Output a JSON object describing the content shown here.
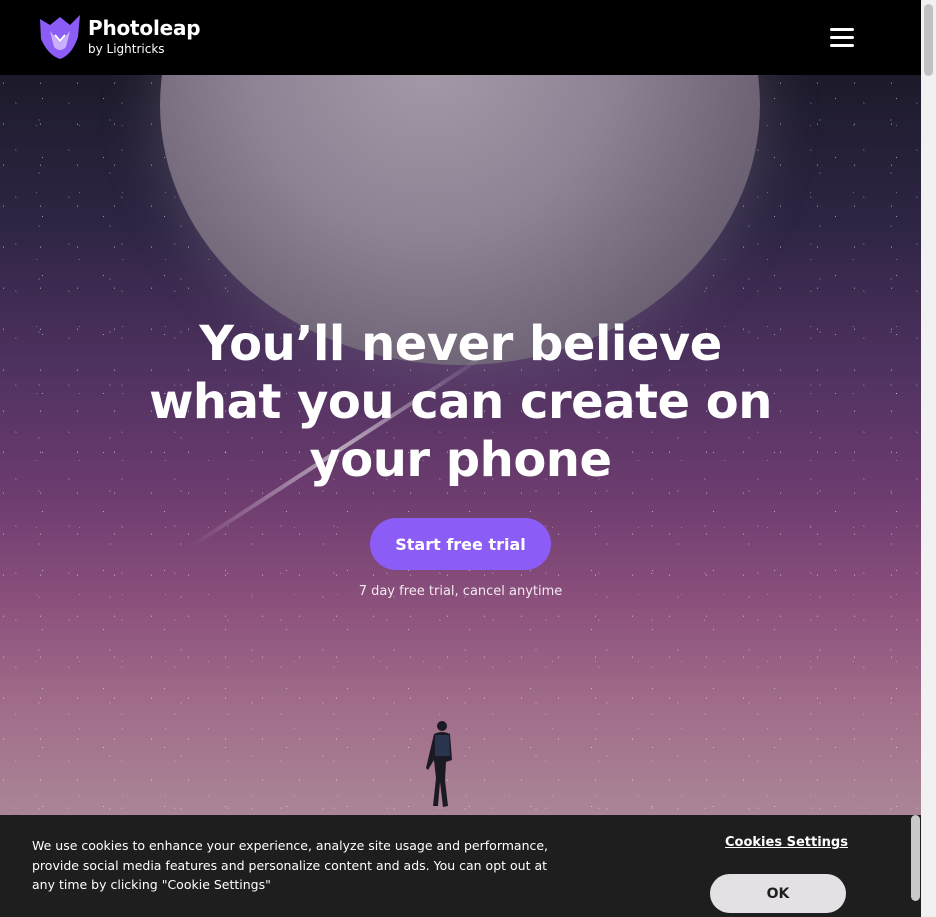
{
  "header": {
    "brand_name": "Photoleap",
    "brand_by": "by Lightricks",
    "logo_icon": "fox-logo-icon",
    "menu_icon": "hamburger-menu-icon"
  },
  "hero": {
    "headline": "You’ll never believe what you can create on your phone",
    "cta_label": "Start free trial",
    "trial_note": "7 day free trial, cancel anytime"
  },
  "cookie_banner": {
    "text": "We use cookies to enhance your experience, analyze site usage and performance, provide social media features and personalize content and ads. You can opt out at any time by clicking \"Cookie Settings\"",
    "settings_label": "Cookies Settings",
    "ok_label": "OK"
  },
  "colors": {
    "accent": "#8c5cf7",
    "header_bg": "#000000",
    "banner_bg": "#1e1e1e"
  }
}
